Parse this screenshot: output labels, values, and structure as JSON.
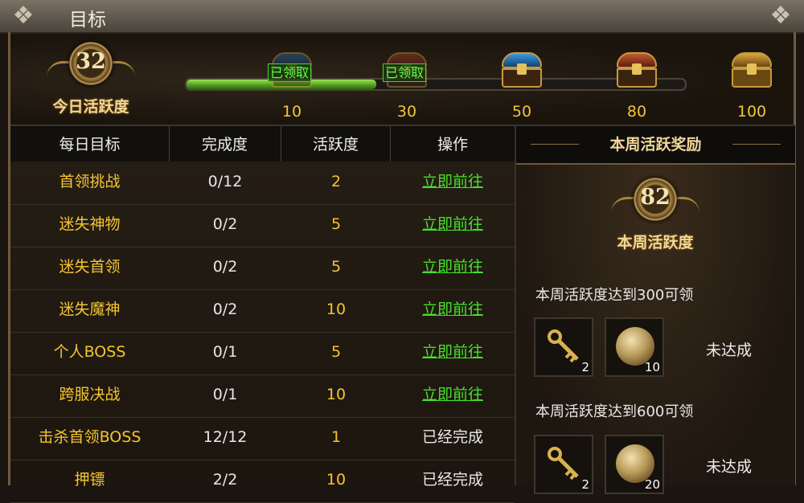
{
  "window": {
    "title": "目标"
  },
  "daily": {
    "activity_value": "32",
    "activity_label": "今日活跃度",
    "progress_fraction": 0.38,
    "milestones": [
      {
        "value": "10",
        "claimed_label": "已领取",
        "claimed": true
      },
      {
        "value": "30",
        "claimed_label": "已领取",
        "claimed": true
      },
      {
        "value": "50",
        "claimed": false
      },
      {
        "value": "80",
        "claimed": false
      },
      {
        "value": "100",
        "claimed": false
      }
    ]
  },
  "table": {
    "headers": [
      "每日目标",
      "完成度",
      "活跃度",
      "操作"
    ],
    "rows": [
      {
        "name": "首领挑战",
        "progress": "0/12",
        "points": "2",
        "action": "立即前往",
        "link": true
      },
      {
        "name": "迷失神物",
        "progress": "0/2",
        "points": "5",
        "action": "立即前往",
        "link": true
      },
      {
        "name": "迷失首领",
        "progress": "0/2",
        "points": "5",
        "action": "立即前往",
        "link": true
      },
      {
        "name": "迷失魔神",
        "progress": "0/2",
        "points": "10",
        "action": "立即前往",
        "link": true
      },
      {
        "name": "个人BOSS",
        "progress": "0/1",
        "points": "5",
        "action": "立即前往",
        "link": true
      },
      {
        "name": "跨服决战",
        "progress": "0/1",
        "points": "10",
        "action": "立即前往",
        "link": true
      },
      {
        "name": "击杀首领BOSS",
        "progress": "12/12",
        "points": "1",
        "action": "已经完成",
        "link": false
      },
      {
        "name": "押镖",
        "progress": "2/2",
        "points": "10",
        "action": "已经完成",
        "link": false
      }
    ]
  },
  "weekly": {
    "header": "本周活跃奖励",
    "activity_value": "82",
    "activity_label": "本周活跃度",
    "goals": [
      {
        "text": "本周活跃度达到300可领",
        "status": "未达成",
        "items": [
          {
            "icon": "key-icon",
            "count": "2"
          },
          {
            "icon": "orb-icon",
            "count": "10"
          }
        ]
      },
      {
        "text": "本周活跃度达到600可领",
        "status": "未达成",
        "items": [
          {
            "icon": "key-icon",
            "count": "2"
          },
          {
            "icon": "orb-icon",
            "count": "20"
          }
        ]
      }
    ]
  }
}
